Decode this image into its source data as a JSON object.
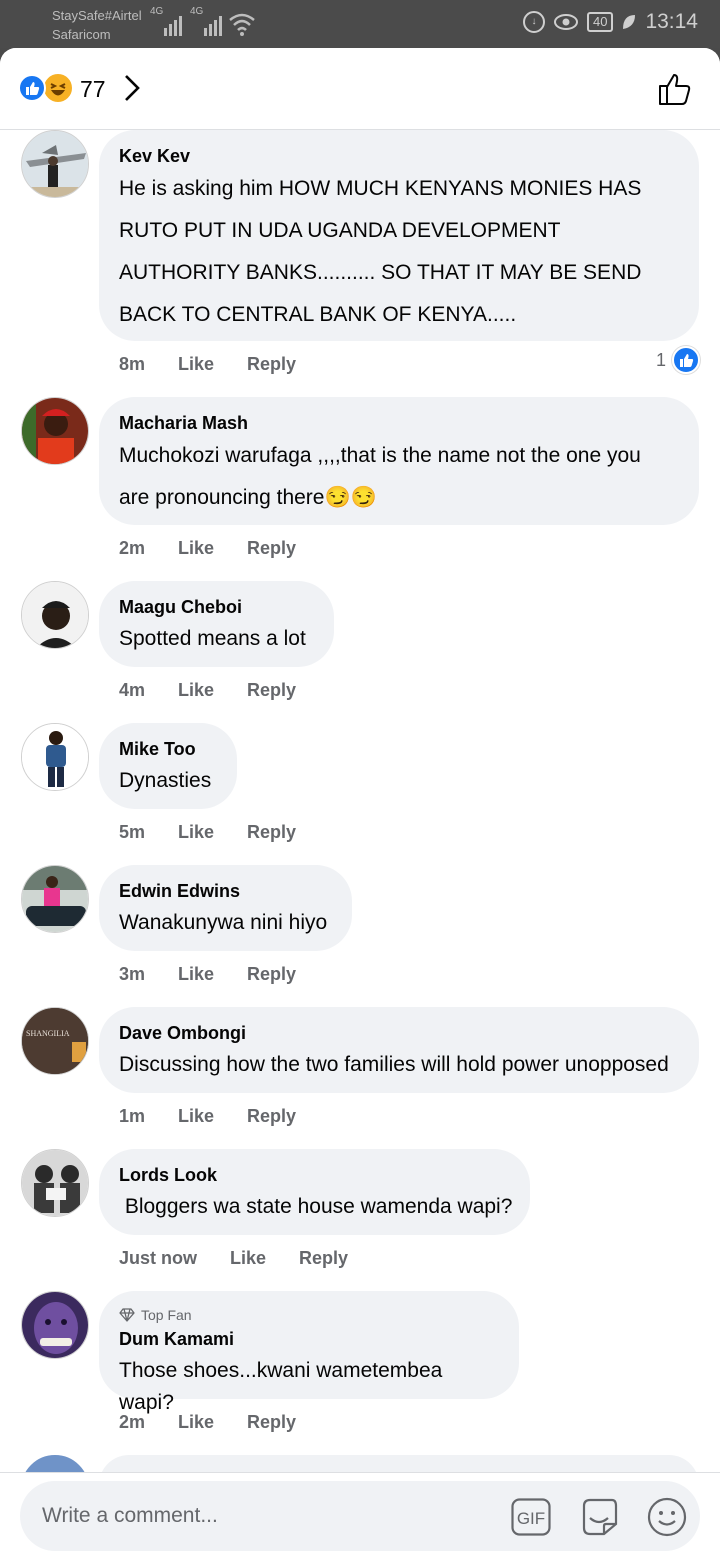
{
  "status_bar": {
    "carrier_1": "StaySafe#Airtel",
    "carrier_2": "Safaricom",
    "net_1": "4G",
    "net_2": "4G",
    "battery": "40",
    "time": "13:14"
  },
  "header": {
    "reaction_count": "77"
  },
  "comments": [
    {
      "author": "Kev Kev",
      "lines": [
        "He is asking him HOW MUCH KENYANS MONIES HAS",
        "RUTO PUT IN UDA UGANDA DEVELOPMENT",
        "AUTHORITY  BANKS.......... SO THAT IT MAY BE SEND",
        "BACK TO CENTRAL BANK OF KENYA....."
      ],
      "time": "8m",
      "like": "Like",
      "reply": "Reply",
      "reaction_count": "1"
    },
    {
      "author": "Macharia Mash",
      "lines": [
        "Muchokozi warufaga ,,,,that is the name not the one you",
        "are pronouncing there😏😏"
      ],
      "time": "2m",
      "like": "Like",
      "reply": "Reply"
    },
    {
      "author": "Maagu Cheboi",
      "lines": [
        "Spotted means a lot"
      ],
      "time": "4m",
      "like": "Like",
      "reply": "Reply"
    },
    {
      "author": "Mike Too",
      "lines": [
        "Dynasties"
      ],
      "time": "5m",
      "like": "Like",
      "reply": "Reply"
    },
    {
      "author": "Edwin Edwins",
      "lines": [
        "Wanakunywa nini hiyo"
      ],
      "time": "3m",
      "like": "Like",
      "reply": "Reply"
    },
    {
      "author": "Dave Ombongi",
      "lines": [
        "Discussing how the two families will hold power unopposed"
      ],
      "time": "1m",
      "like": "Like",
      "reply": "Reply",
      "avatar_text": "SHANGILIA"
    },
    {
      "author": "Lords Look",
      "lines": [
        " Bloggers wa state house wamenda wapi?"
      ],
      "time": "Just now",
      "like": "Like",
      "reply": "Reply"
    },
    {
      "author": "Dum Kamami",
      "badge": "Top Fan",
      "lines": [
        "Those shoes...kwani wametembea wapi?"
      ],
      "time": "2m",
      "like": "Like",
      "reply": "Reply"
    }
  ],
  "composer": {
    "placeholder": "Write a comment...",
    "gif_label": "GIF"
  },
  "colors": {
    "accent": "#1877f2",
    "bubble": "#f0f2f5",
    "meta": "#65676b"
  }
}
